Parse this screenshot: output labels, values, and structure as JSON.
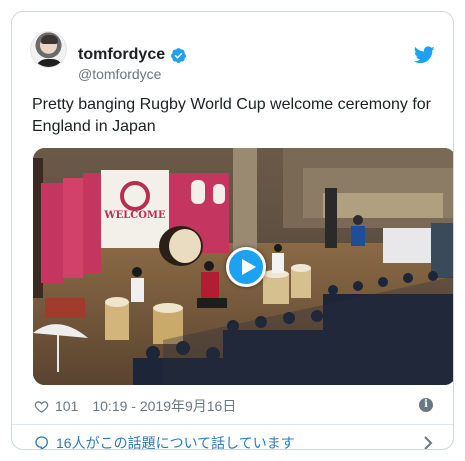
{
  "tweet": {
    "author": {
      "display_name": "tomfordyce",
      "handle": "@tomfordyce",
      "verified": true
    },
    "text": "Pretty banging Rugby World Cup welcome ceremony for England in Japan",
    "media": {
      "type": "video",
      "icon": "play-icon",
      "banner_text": "WELCOME"
    },
    "likes": "101",
    "timestamp": "10:19 - 2019年9月16日",
    "conversation_link": "16人がこの話題について話しています"
  },
  "colors": {
    "accent": "#1da1f2",
    "link": "#2b7bb9",
    "muted": "#697882",
    "text": "#1c2022",
    "border": "#cfd9de"
  },
  "icons": [
    "avatar",
    "verified-badge-icon",
    "twitter-bird-icon",
    "play-icon",
    "heart-icon",
    "info-icon",
    "speech-bubble-icon",
    "chevron-right-icon"
  ]
}
